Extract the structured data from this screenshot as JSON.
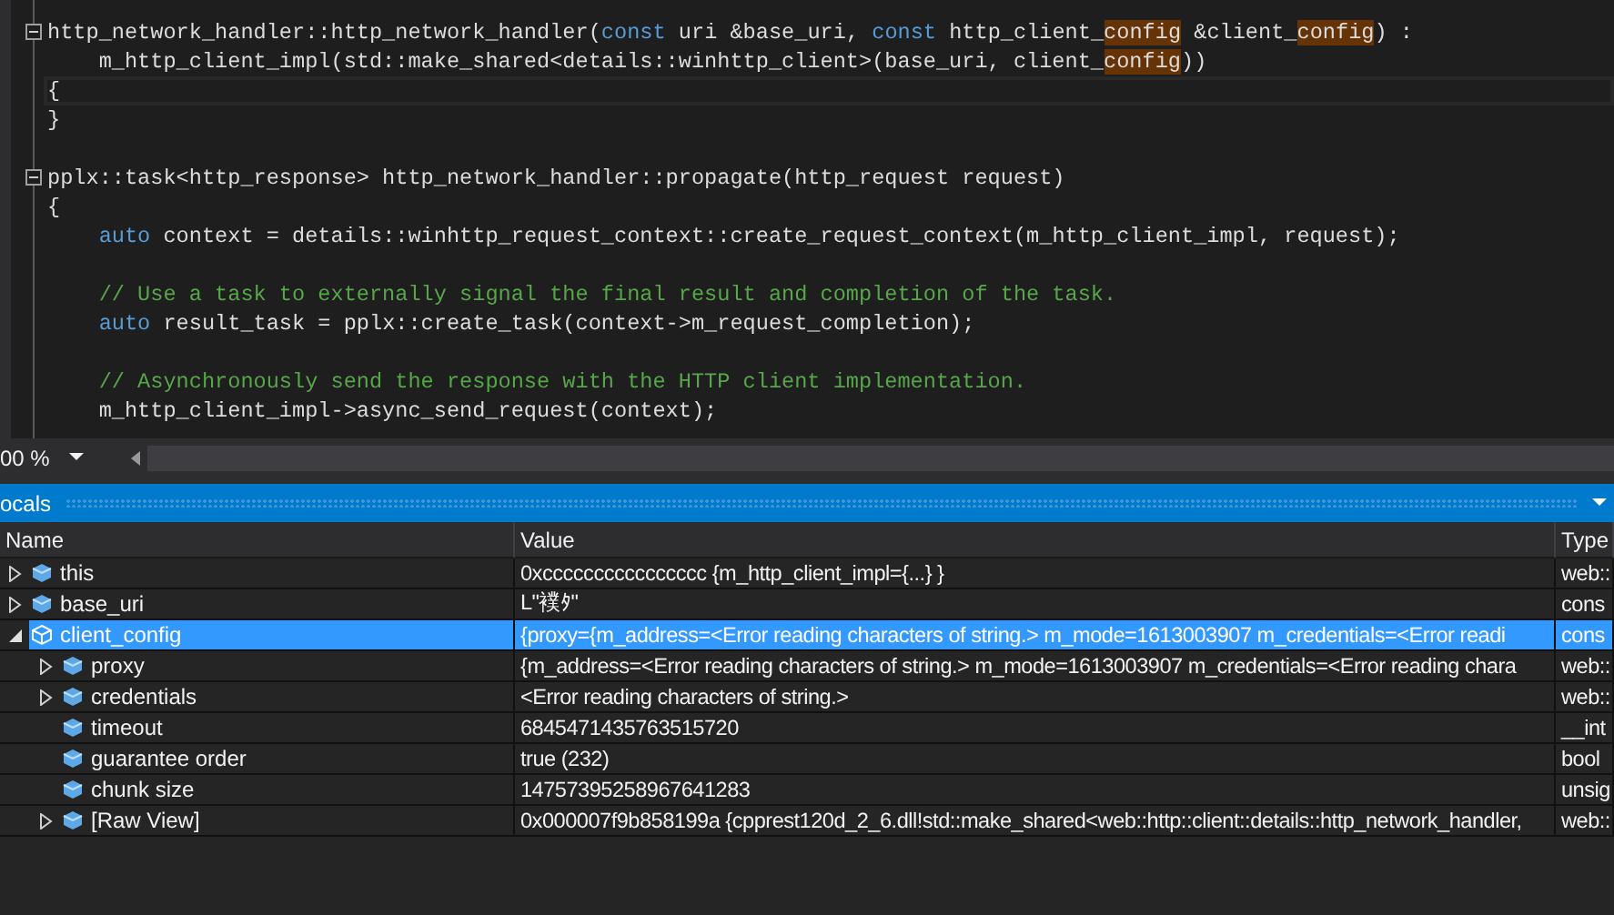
{
  "editor": {
    "lines": [
      {
        "kind": "code",
        "fold": true,
        "current": false,
        "tokens": [
          {
            "text": "http_network_handler::http_network_handler(",
            "kind": "plain"
          },
          {
            "text": "const",
            "kind": "keyword"
          },
          {
            "text": " uri &base_uri, ",
            "kind": "plain"
          },
          {
            "text": "const",
            "kind": "keyword"
          },
          {
            "text": " http_client_",
            "kind": "plain"
          },
          {
            "text": "config",
            "kind": "match"
          },
          {
            "text": " &client_",
            "kind": "plain"
          },
          {
            "text": "config",
            "kind": "match"
          },
          {
            "text": ") :",
            "kind": "plain"
          }
        ]
      },
      {
        "kind": "code",
        "fold": false,
        "current": false,
        "tokens": [
          {
            "text": "    m_http_client_impl(std::make_shared<details::winhttp_client>(base_uri, client_",
            "kind": "plain"
          },
          {
            "text": "config",
            "kind": "match"
          },
          {
            "text": "))",
            "kind": "plain"
          }
        ]
      },
      {
        "kind": "code",
        "fold": false,
        "current": true,
        "tokens": [
          {
            "text": "{",
            "kind": "plain"
          }
        ]
      },
      {
        "kind": "code",
        "fold": false,
        "current": false,
        "tokens": [
          {
            "text": "}",
            "kind": "plain"
          }
        ]
      },
      {
        "kind": "blank"
      },
      {
        "kind": "code",
        "fold": true,
        "current": false,
        "tokens": [
          {
            "text": "pplx::task<http_response> http_network_handler::propagate(http_request request)",
            "kind": "plain"
          }
        ]
      },
      {
        "kind": "code",
        "fold": false,
        "current": false,
        "tokens": [
          {
            "text": "{",
            "kind": "plain"
          }
        ]
      },
      {
        "kind": "code",
        "fold": false,
        "current": false,
        "tokens": [
          {
            "text": "    auto",
            "kind": "keyword"
          },
          {
            "text": " context = details::winhttp_request_context::create_request_context(m_http_client_impl, request);",
            "kind": "plain"
          }
        ]
      },
      {
        "kind": "blank"
      },
      {
        "kind": "code",
        "fold": false,
        "current": false,
        "tokens": [
          {
            "text": "    // Use a task to externally signal the final result and completion of the task.",
            "kind": "comment"
          }
        ]
      },
      {
        "kind": "code",
        "fold": false,
        "current": false,
        "tokens": [
          {
            "text": "    auto",
            "kind": "keyword"
          },
          {
            "text": " result_task = pplx::create_task(context->m_request_completion);",
            "kind": "plain"
          }
        ]
      },
      {
        "kind": "blank"
      },
      {
        "kind": "code",
        "fold": false,
        "current": false,
        "tokens": [
          {
            "text": "    // Asynchronously send the response with the HTTP client implementation.",
            "kind": "comment"
          }
        ]
      },
      {
        "kind": "code",
        "fold": false,
        "current": false,
        "tokens": [
          {
            "text": "    m_http_client_impl->async_send_request(context);",
            "kind": "plain"
          }
        ]
      }
    ]
  },
  "zoom_bar": {
    "zoom": "00 %"
  },
  "locals": {
    "title": "ocals",
    "columns": [
      "Name",
      "Value",
      "Type"
    ],
    "rows": [
      {
        "name": "this",
        "value": "0xcccccccccccccccc {m_http_client_impl={...} }",
        "type": "web::",
        "expandable": true,
        "expanded": false,
        "selected": false
      },
      {
        "name": "base_uri",
        "value": "L\"襆ﾀ\"",
        "type": "cons",
        "expandable": true,
        "expanded": false,
        "selected": false
      },
      {
        "name": "client_config",
        "value": "{proxy={m_address=<Error reading characters of string.> m_mode=1613003907 m_credentials=<Error readi",
        "type": "cons",
        "expandable": true,
        "expanded": true,
        "selected": true,
        "children": [
          {
            "name": "proxy",
            "value": "{m_address=<Error reading characters of string.> m_mode=1613003907 m_credentials=<Error reading chara",
            "type": "web::",
            "expandable": true,
            "expanded": false,
            "selected": false
          },
          {
            "name": "credentials",
            "value": "<Error reading characters of string.>",
            "type": "web::",
            "expandable": true,
            "expanded": false,
            "selected": false
          },
          {
            "name": "timeout",
            "value": "6845471435763515720",
            "type": "__int",
            "expandable": false,
            "selected": false
          },
          {
            "name": "guarantee order",
            "value": "true (232)",
            "type": "bool",
            "expandable": false,
            "selected": false
          },
          {
            "name": "chunk size",
            "value": "14757395258967641283",
            "type": "unsig",
            "expandable": false,
            "selected": false
          },
          {
            "name": "[Raw View]",
            "value": "0x000007f9b858199a {cpprest120d_2_6.dll!std::make_shared<web::http::client::details::http_network_handler,",
            "type": "web::",
            "expandable": true,
            "expanded": false,
            "selected": false
          }
        ]
      }
    ]
  }
}
